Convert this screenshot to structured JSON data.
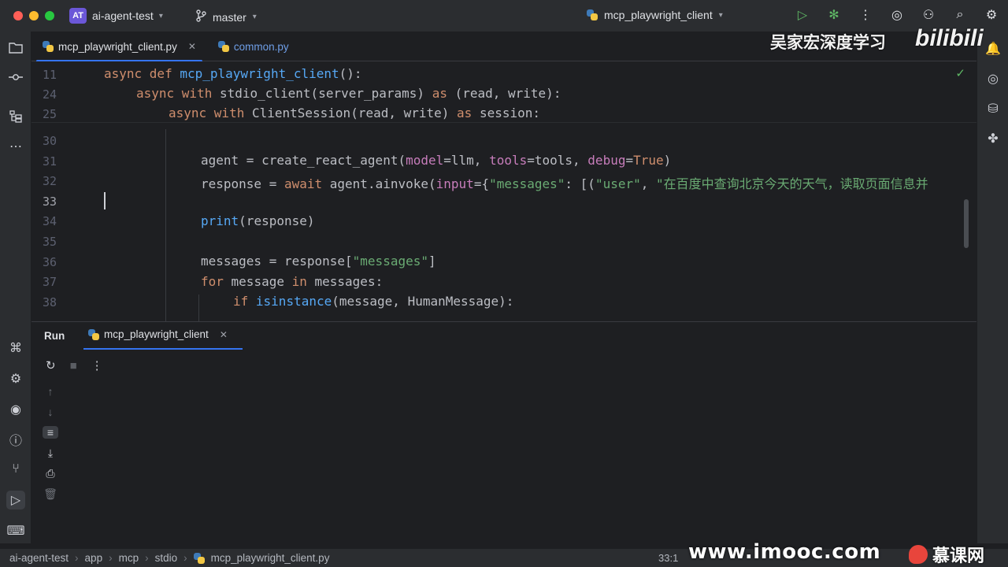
{
  "titlebar": {
    "project_badge": "AT",
    "project_name": "ai-agent-test",
    "branch": "master",
    "run_config": "mcp_playwright_client"
  },
  "tabs": [
    {
      "label": "mcp_playwright_client.py",
      "active": true
    },
    {
      "label": "common.py",
      "active": false
    }
  ],
  "watermark": {
    "author": "吴家宏深度学习",
    "platform": "bilibili",
    "site": "www.imooc.com",
    "logo_text": "慕课网"
  },
  "editor": {
    "sticky_lines": [
      {
        "num": "11",
        "code": "async def mcp_playwright_client():"
      },
      {
        "num": "24",
        "code": "    async with stdio_client(server_params) as (read, write):"
      },
      {
        "num": "25",
        "code": "        async with ClientSession(read, write) as session:"
      }
    ],
    "lines": [
      {
        "num": "30",
        "code": ""
      },
      {
        "num": "31",
        "code": "agent = create_react_agent(model=llm, tools=tools, debug=True)"
      },
      {
        "num": "32",
        "code": "response = await agent.ainvoke(input={\"messages\": [(\"user\", \"在百度中查询北京今天的天气，读取页面信息并"
      },
      {
        "num": "33",
        "code": ""
      },
      {
        "num": "34",
        "code": "print(response)"
      },
      {
        "num": "35",
        "code": ""
      },
      {
        "num": "36",
        "code": "messages = response[\"messages\"]"
      },
      {
        "num": "37",
        "code": "for message in messages:"
      },
      {
        "num": "38",
        "code": "if isinstance(message, HumanMessage):"
      }
    ],
    "cursor_position": "33:1"
  },
  "run_panel": {
    "title": "Run",
    "tab_label": "mcp_playwright_client"
  },
  "statusbar": {
    "breadcrumb": [
      "ai-agent-test",
      "app",
      "mcp",
      "stdio",
      "mcp_playwright_client.py"
    ],
    "position": "33:1"
  }
}
